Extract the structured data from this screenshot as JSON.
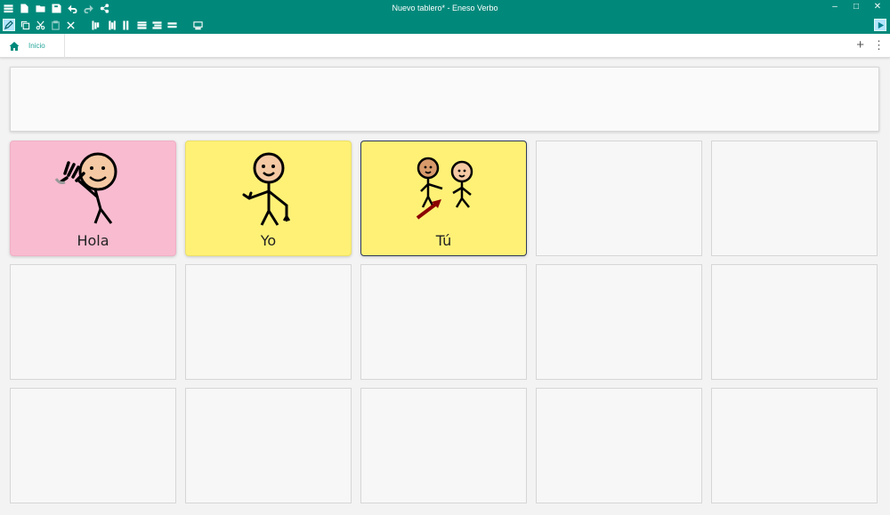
{
  "window": {
    "title": "Nuevo tablero* - Eneso Verbo",
    "minimize": "–",
    "maximize": "□",
    "close": "✕"
  },
  "tabs": [
    {
      "label": "Inicio"
    }
  ],
  "tab_actions": {
    "add": "+",
    "more": "⋮"
  },
  "grid": {
    "cells": [
      {
        "label": "Hola",
        "color": "#f8bbd0"
      },
      {
        "label": "Yo",
        "color": "#fff176"
      },
      {
        "label": "Tú",
        "color": "#fff176"
      }
    ]
  },
  "colors": {
    "accent": "#00897b"
  }
}
